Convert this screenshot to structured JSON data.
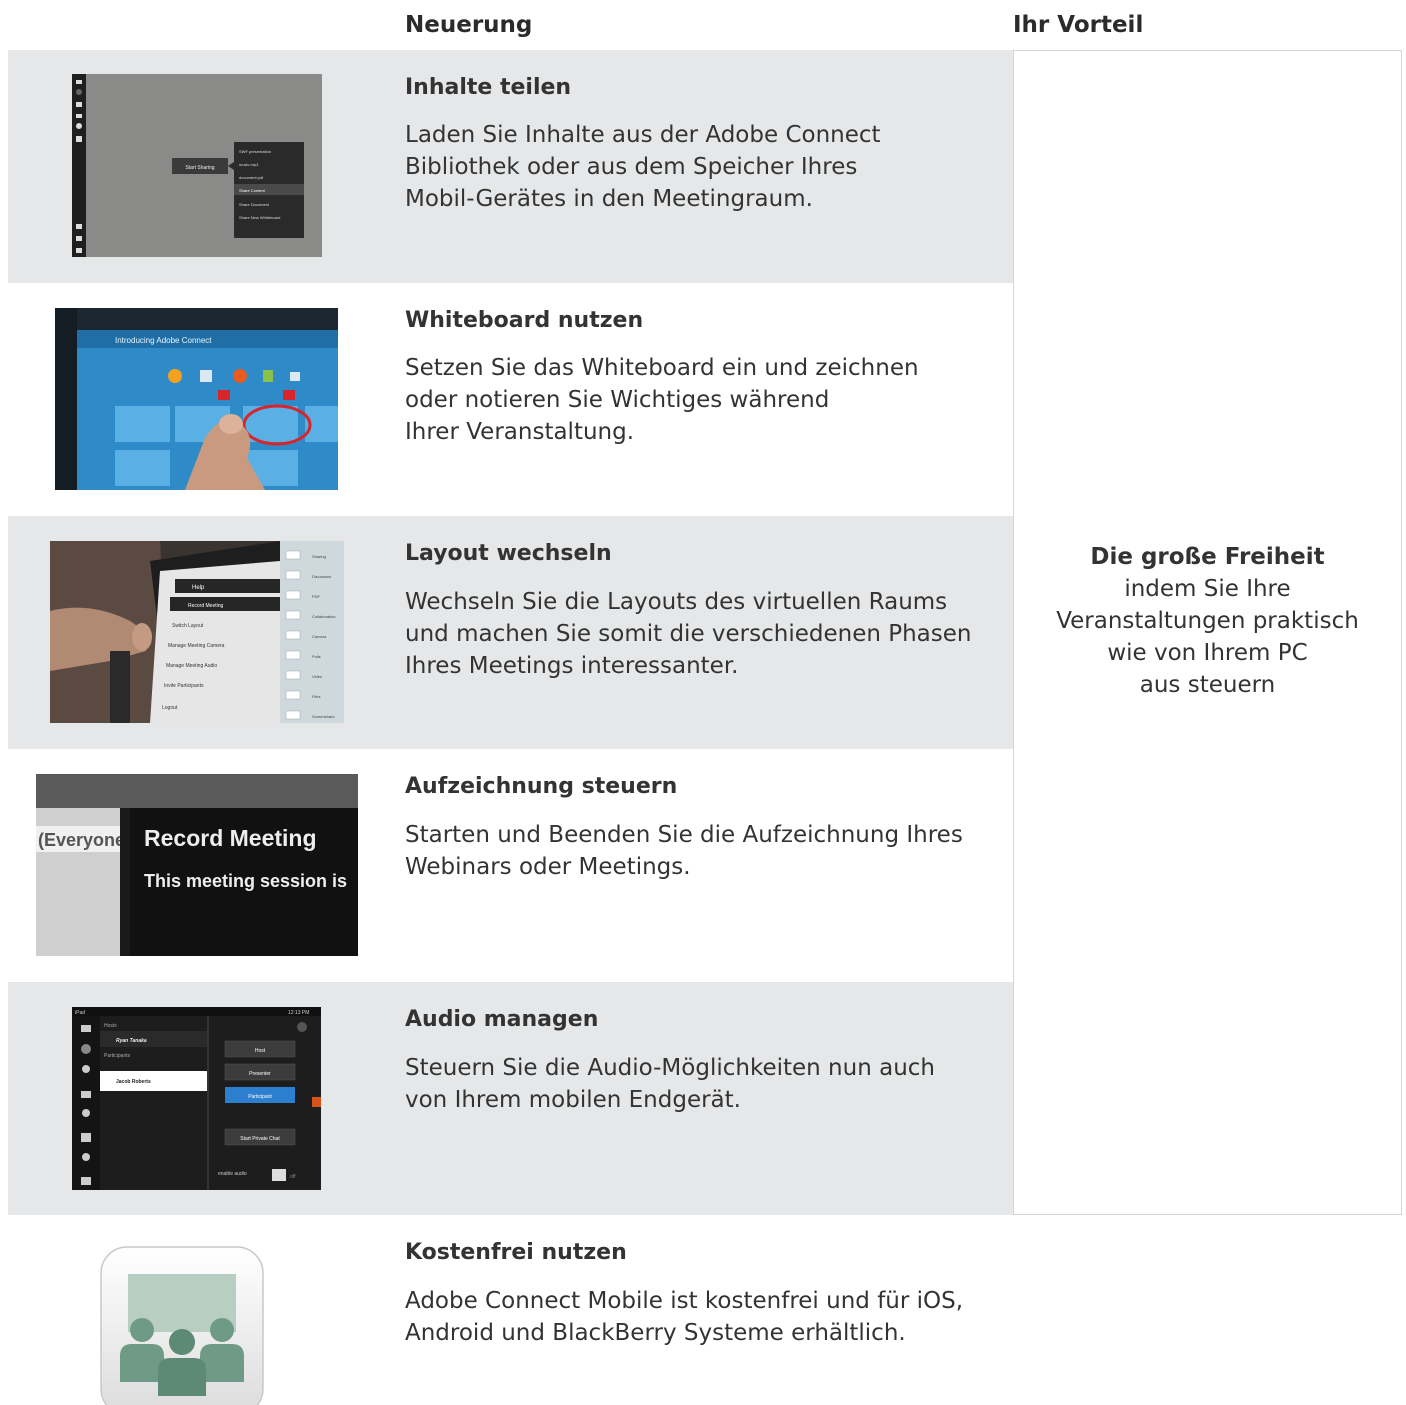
{
  "header": {
    "col_neuerung": "Neuerung",
    "col_vorteil": "Ihr Vorteil"
  },
  "rows": [
    {
      "title": "Inhalte teilen",
      "lines": [
        "Laden Sie Inhalte aus der Adobe Connect",
        "Bibliothek oder aus dem Speicher Ihres",
        "Mobil-Gerätes in den Meetingraum."
      ],
      "thumb": {
        "start": "Start Sharing",
        "menu": [
          "SWF presentation",
          "music.mp3",
          "document.pdf",
          "Share Content",
          "Share Document",
          "Share New Whiteboard"
        ]
      }
    },
    {
      "title": "Whiteboard nutzen",
      "lines": [
        "Setzen Sie das Whiteboard ein und zeichnen",
        "oder notieren Sie Wichtiges während",
        "Ihrer Veranstaltung."
      ],
      "thumb": {
        "heading": "Introducing Adobe Connect"
      }
    },
    {
      "title": "Layout wechseln",
      "lines": [
        "Wechseln Sie die Layouts des virtuellen Raums",
        "und machen Sie somit die verschiedenen Phasen",
        "Ihres Meetings interessanter."
      ],
      "thumb": {
        "menu": [
          "Help",
          "Record Meeting",
          "Switch Layout",
          "Manage Meeting Camera",
          "Manage Meeting Audio",
          "Invite Participants",
          "Logout"
        ],
        "layouts": [
          "Sharing",
          "Discussion",
          "PDF",
          "Collaboration",
          "Camera",
          "Polls",
          "Video",
          "Files",
          "Screenshare"
        ]
      }
    },
    {
      "title": "Aufzeichnung steuern",
      "lines": [
        "Starten und Beenden Sie die Aufzeichnung Ihres",
        "Webinars oder Meetings."
      ],
      "thumb": {
        "left": "(Everyone",
        "heading": "Record Meeting",
        "sub": "This meeting session is"
      }
    },
    {
      "title": "Audio managen",
      "lines": [
        "Steuern Sie die Audio-Möglichkeiten nun auch",
        "von Ihrem mobilen Endgerät."
      ],
      "thumb": {
        "device": "iPad",
        "time": "12:13 PM",
        "hosts": "Hosts",
        "host_name": "Ryan Tanaka",
        "participants": "Participants",
        "participant_name": "Jacob Roberts",
        "buttons": [
          "Host",
          "Presenter",
          "Participant"
        ],
        "chat": "Start Private Chat",
        "enable": "enable audio",
        "off": "off"
      }
    },
    {
      "title": "Kostenfrei nutzen",
      "lines": [
        "Adobe Connect Mobile ist kostenfrei und für iOS,",
        "Android und BlackBerry Systeme erhältlich."
      ]
    }
  ],
  "vorteil": {
    "headline": "Die große Freiheit",
    "lines": [
      "indem Sie Ihre",
      "Veranstaltungen praktisch",
      "wie von Ihrem PC",
      "aus steuern"
    ]
  },
  "colors": {
    "row_grey": "#e6e7e8",
    "text": "#333333",
    "icon_green": "#6f9a86"
  }
}
